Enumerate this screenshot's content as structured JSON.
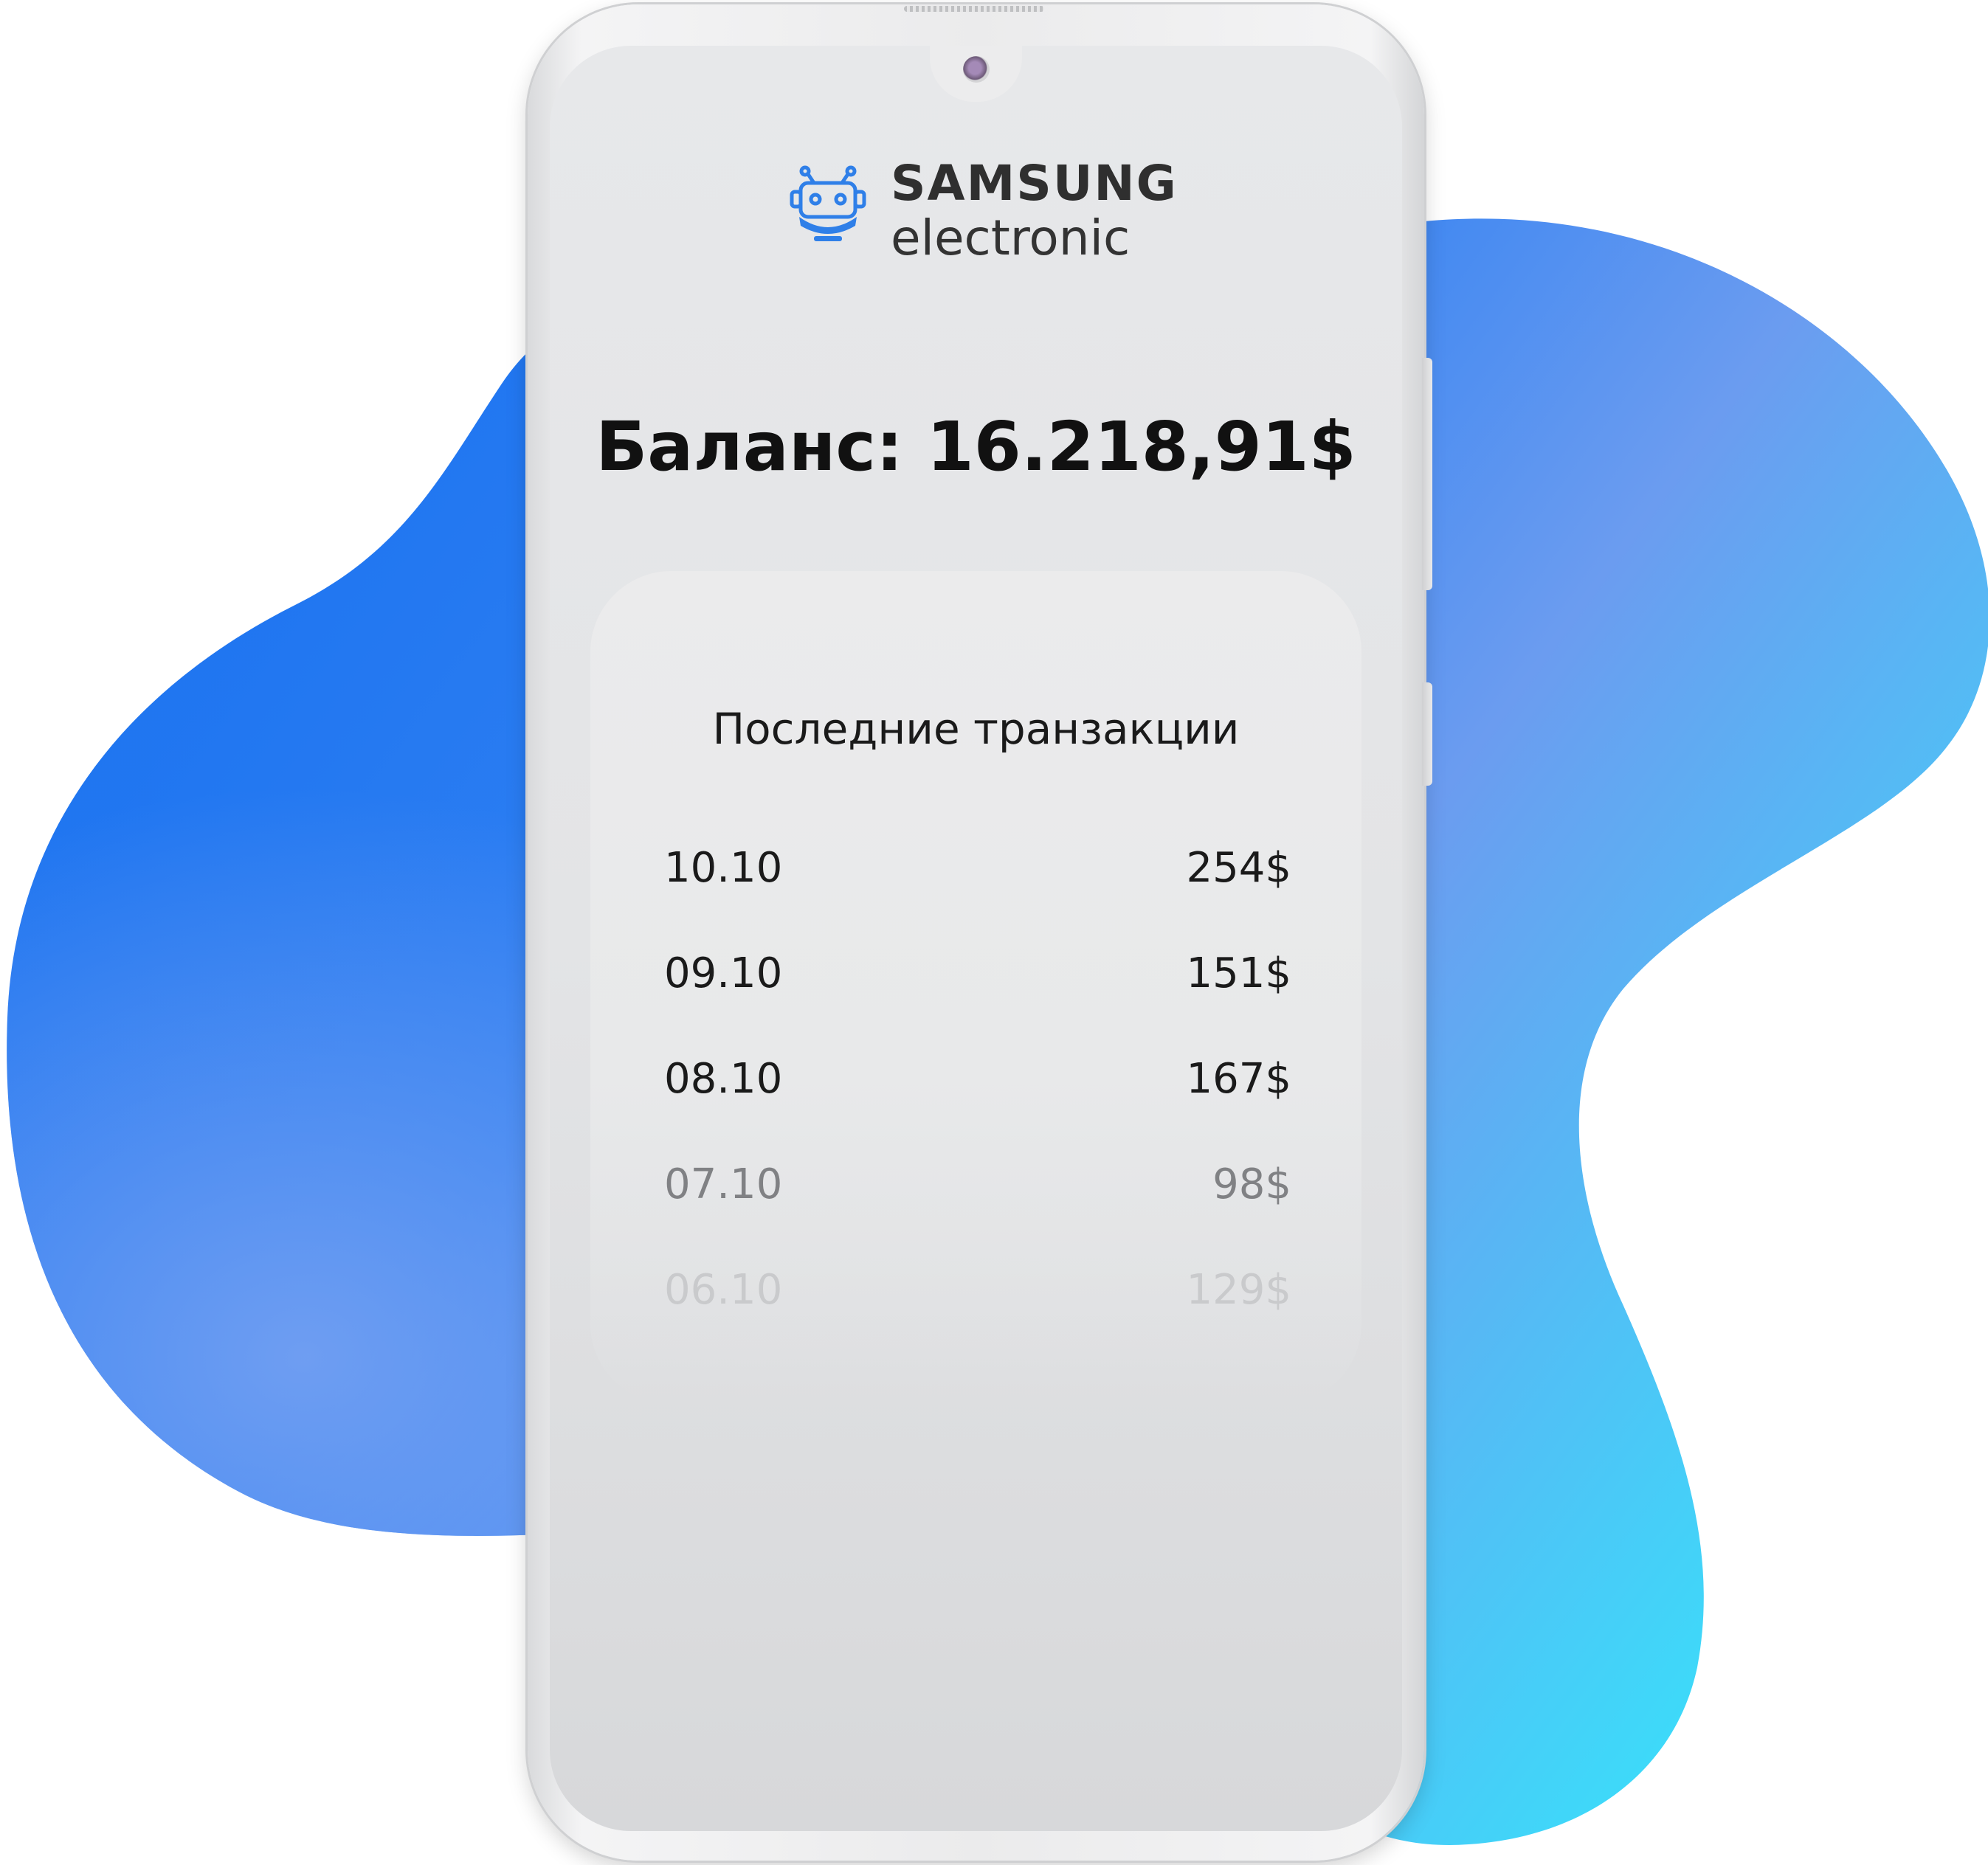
{
  "app": {
    "brand_name": "SAMSUNG",
    "brand_sub": "electronic",
    "logo_icon": "robot-icon",
    "accent_color": "#2f7fe8"
  },
  "balance": {
    "text": "Баланс: 16.218,91$"
  },
  "transactions": {
    "title": "Последние транзакции",
    "items": [
      {
        "date": "10.10",
        "amount": "254$"
      },
      {
        "date": "09.10",
        "amount": "151$"
      },
      {
        "date": "08.10",
        "amount": "167$"
      },
      {
        "date": "07.10",
        "amount": "98$"
      },
      {
        "date": "06.10",
        "amount": "129$"
      }
    ]
  },
  "colors": {
    "blob_start": "#1a72f0",
    "blob_end": "#36e4fb",
    "phone_frame": "#ebebec",
    "screen_bg": "#e5e6e8",
    "text_primary": "#111111"
  }
}
